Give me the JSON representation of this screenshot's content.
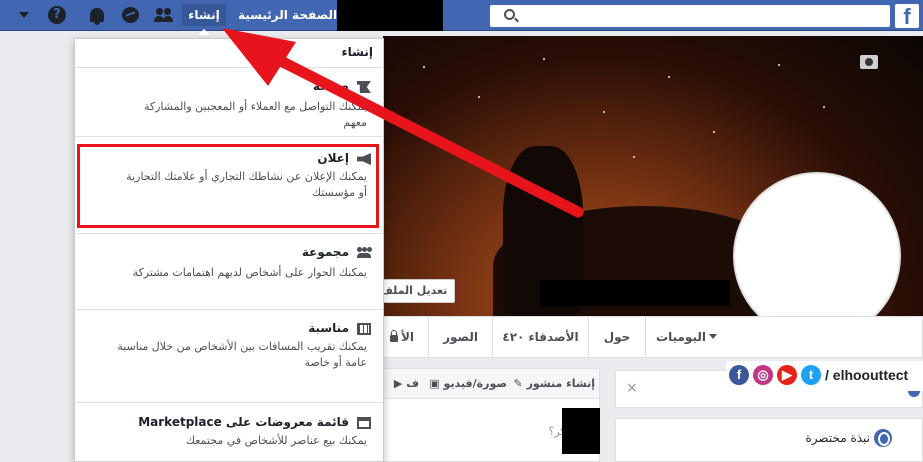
{
  "topbar": {
    "logo": "f",
    "search_placeholder": "",
    "home_label": "الصفحة الرئيسية",
    "create_label": "إنشاء",
    "help_glyph": "?"
  },
  "dropdown": {
    "title": "إنشاء",
    "items": [
      {
        "name": "صفحة",
        "desc": "يمكنك التواصل مع العملاء أو المعجبين والمشاركة معهم",
        "icon": "flag-icon"
      },
      {
        "name": "إعلان",
        "desc": "يمكنك الإعلان عن نشاطك التجاري أو علامتك التجارية أو مؤسستك",
        "icon": "megaphone-icon"
      },
      {
        "name": "مجموعة",
        "desc": "يمكنك الحوار على أشخاص لديهم اهتمامات مشتركة",
        "icon": "group-icon"
      },
      {
        "name": "مناسبة",
        "desc": "يمكنك تقريب المسافات بين الأشخاص من خلال مناسبة عامة أو خاصة",
        "icon": "calendar-icon"
      },
      {
        "name": "قائمة معروضات على Marketplace",
        "desc": "يمكنك بيع عناصر للأشخاص في مجتمعك",
        "icon": "store-icon"
      }
    ]
  },
  "cover": {
    "edit_label": "تعديل الملف"
  },
  "tabs": {
    "timeline": "اليوميات",
    "about": "حول",
    "friends": "الأصدقاء ٤٢٠",
    "photos": "الصور",
    "more": "الأ"
  },
  "composer": {
    "post": "إنشاء منشور",
    "photo_video": "صورة/فيديو",
    "live": "ف",
    "placeholder": "بم تفكر؟"
  },
  "sidebar": {
    "close_glyph": "×",
    "intro_title": "نبذة مختصرة"
  },
  "watermark": {
    "text": "/ elhoouttect",
    "icons": [
      "f",
      "◎",
      "▶",
      "t"
    ]
  },
  "colors": {
    "fb_blue": "#4267b2",
    "highlight_red": "#e8141c"
  }
}
